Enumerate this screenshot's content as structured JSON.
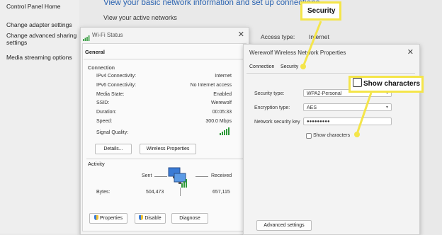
{
  "control_panel": {
    "header": "View your basic network information and set up connections",
    "subheader": "View your active networks",
    "links": [
      "Control Panel Home",
      "Change adapter settings",
      "Change advanced sharing settings",
      "Media streaming options"
    ],
    "access_type_label": "Access type:",
    "access_type_value": "Internet"
  },
  "wifi_status": {
    "title": "Wi-Fi Status",
    "tab": "General",
    "connection_heading": "Connection",
    "rows": [
      {
        "label": "IPv4 Connectivity:",
        "value": "Internet"
      },
      {
        "label": "IPv6 Connectivity:",
        "value": "No Internet access"
      },
      {
        "label": "Media State:",
        "value": "Enabled"
      },
      {
        "label": "SSID:",
        "value": "Werewolf"
      },
      {
        "label": "Duration:",
        "value": "00:05:33"
      },
      {
        "label": "Speed:",
        "value": "300.0 Mbps"
      }
    ],
    "signal_label": "Signal Quality:",
    "signal_bars": 5,
    "details_button": "Details...",
    "wireless_props_button": "Wireless Properties",
    "activity_heading": "Activity",
    "sent_label": "Sent",
    "received_label": "Received",
    "bytes_label": "Bytes:",
    "bytes_sent": "504,473",
    "bytes_received": "657,115",
    "properties_button": "Properties",
    "disable_button": "Disable",
    "diagnose_button": "Diagnose"
  },
  "wireless_props": {
    "title": "Werewolf Wireless Network Properties",
    "tabs": [
      "Connection",
      "Security"
    ],
    "security_type_label": "Security type:",
    "security_type_value": "WPA2-Personal",
    "encryption_type_label": "Encryption type:",
    "encryption_type_value": "AES",
    "key_label": "Network security key",
    "key_value": "●●●●●●●●●",
    "show_chars_label": "Show characters",
    "advanced_button": "Advanced settings"
  },
  "callouts": {
    "security": "Security",
    "show_characters": "Show characters"
  },
  "colors": {
    "accent_yellow": "#f4e54a",
    "link_blue": "#2b63b0",
    "signal_green": "#2f9a3a"
  }
}
